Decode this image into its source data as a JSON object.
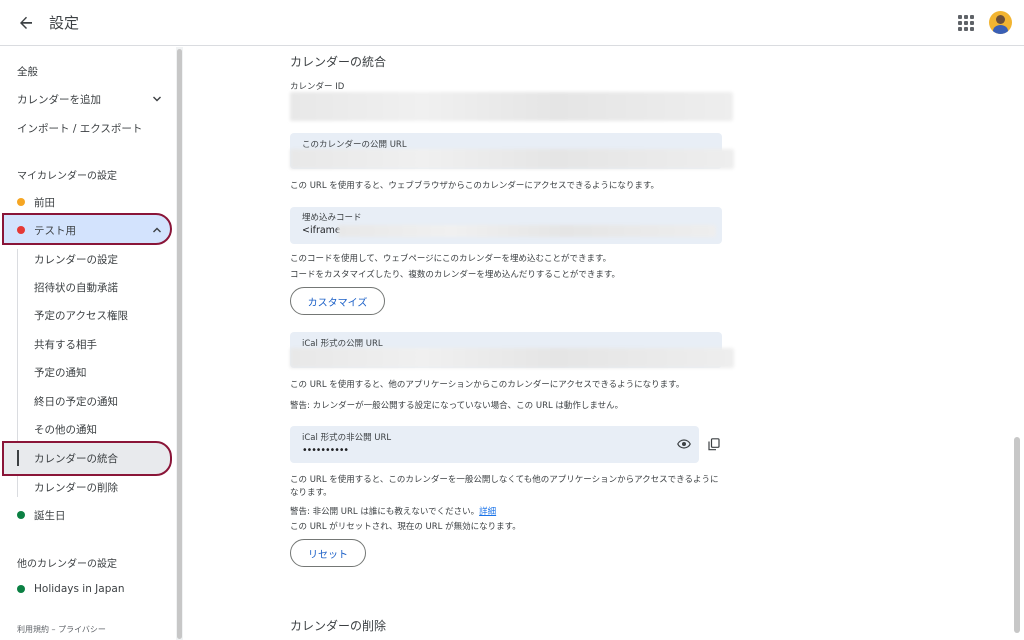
{
  "header": {
    "title": "設定"
  },
  "sidebar": {
    "general": "全般",
    "add_calendar": "カレンダーを追加",
    "import_export": "インポート / エクスポート",
    "my_calendars_title": "マイカレンダーの設定",
    "calendars": [
      {
        "label": "前田",
        "color": "#f6a623"
      },
      {
        "label": "テスト用",
        "color": "#e53935"
      }
    ],
    "sub_items": [
      "カレンダーの設定",
      "招待状の自動承諾",
      "予定のアクセス権限",
      "共有する相手",
      "予定の通知",
      "終日の予定の通知",
      "その他の通知",
      "カレンダーの統合",
      "カレンダーの削除"
    ],
    "birthday": {
      "label": "誕生日",
      "color": "#0b8043"
    },
    "other_title": "他のカレンダーの設定",
    "holidays": {
      "label": "Holidays in Japan",
      "color": "#0b8043"
    },
    "footer": "利用規約 – プライバシー"
  },
  "main": {
    "integrate_title": "カレンダーの統合",
    "calendar_id_label": "カレンダー ID",
    "public_url_label": "このカレンダーの公開 URL",
    "public_url_help": "この URL を使用すると、ウェブブラウザからこのカレンダーにアクセスできるようになります。",
    "embed_label": "埋め込みコード",
    "embed_value": "<iframe",
    "embed_help1": "このコードを使用して、ウェブページにこのカレンダーを埋め込むことができます。",
    "embed_help2": "コードをカスタマイズしたり、複数のカレンダーを埋め込んだりすることができます。",
    "customize_button": "カスタマイズ",
    "ical_public_label": "iCal 形式の公開 URL",
    "ical_public_help": "この URL を使用すると、他のアプリケーションからこのカレンダーにアクセスできるようになります。",
    "ical_public_warning": "警告: カレンダーが一般公開する設定になっていない場合、この URL は動作しません。",
    "ical_private_label": "iCal 形式の非公開 URL",
    "ical_private_value": "••••••••••",
    "ical_private_help1": "この URL を使用すると、このカレンダーを一般公開しなくても他のアプリケーションからアクセスできるように",
    "ical_private_help2": "なります。",
    "ical_private_warning": "警告: 非公開 URL は誰にも教えないでください。",
    "details_link": "詳細",
    "reset_help": "この URL がリセットされ、現在の URL が無効になります。",
    "reset_button": "リセット",
    "delete_title": "カレンダーの削除"
  }
}
